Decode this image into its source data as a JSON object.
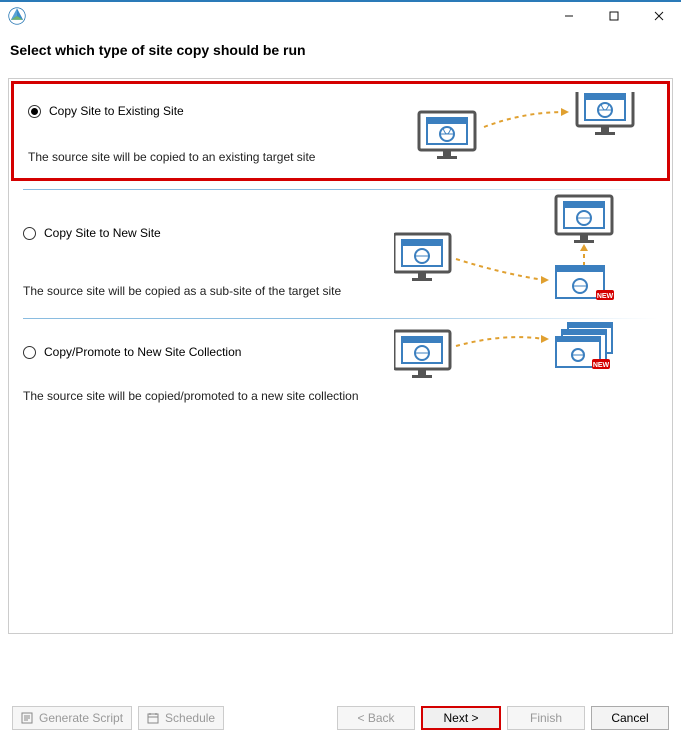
{
  "window": {
    "min_icon": "minimize-icon",
    "max_icon": "maximize-icon",
    "close_icon": "close-icon"
  },
  "heading": "Select which type of site copy should be run",
  "options": [
    {
      "label": "Copy Site to Existing Site",
      "desc": "The source site will be copied to an existing target site",
      "selected": true
    },
    {
      "label": "Copy Site to New Site",
      "desc": "The source site will be copied as a sub-site of the target site",
      "selected": false
    },
    {
      "label": "Copy/Promote to New Site Collection",
      "desc": "The source site will be copied/promoted to a new site collection",
      "selected": false
    }
  ],
  "buttons": {
    "generate_script": "Generate Script",
    "schedule": "Schedule",
    "back": "< Back",
    "next": "Next >",
    "finish": "Finish",
    "cancel": "Cancel"
  },
  "badge": {
    "new": "NEW"
  }
}
